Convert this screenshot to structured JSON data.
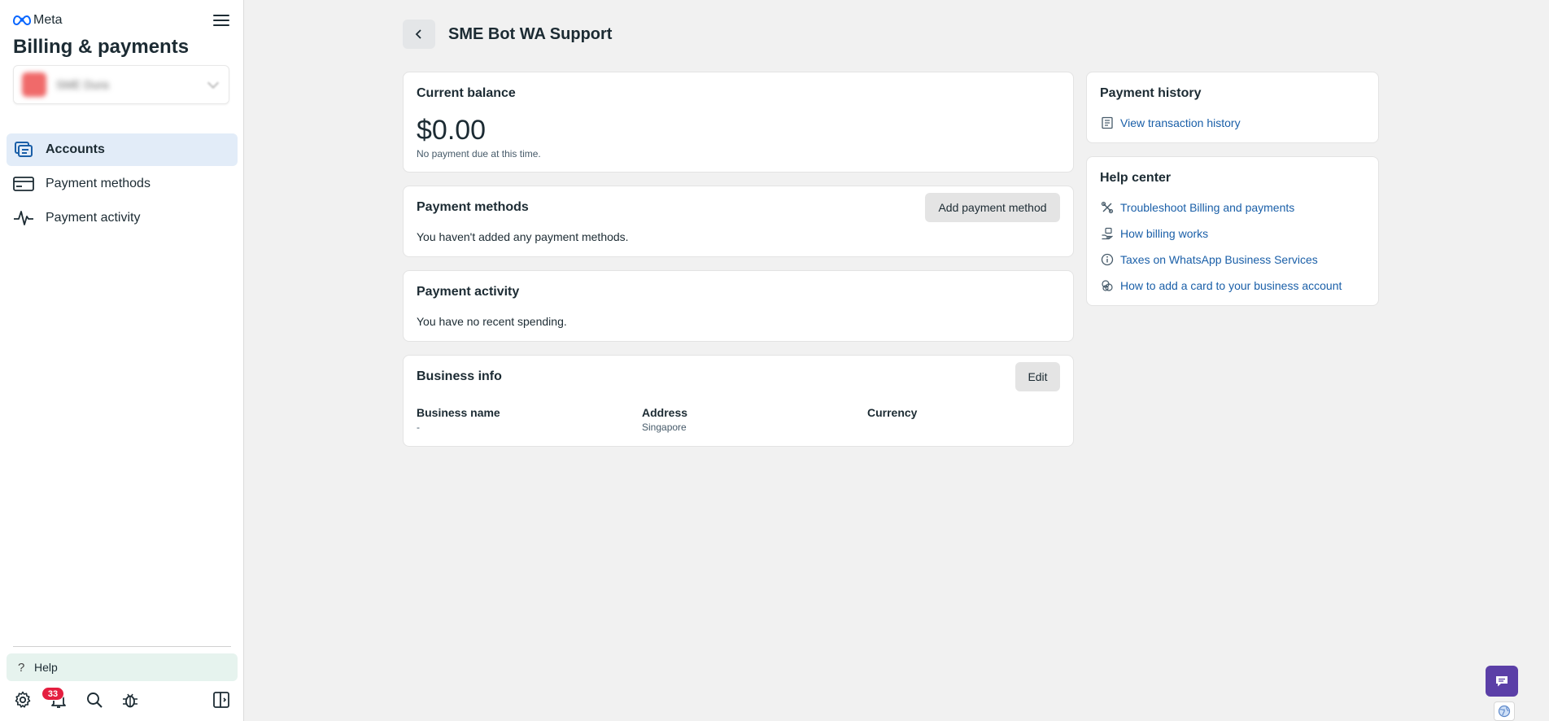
{
  "sidebar": {
    "brand": "Meta",
    "title": "Billing & payments",
    "account": {
      "name": "SME Dura"
    },
    "items": [
      {
        "label": "Accounts",
        "icon": "accounts-icon",
        "active": true
      },
      {
        "label": "Payment methods",
        "icon": "credit-card-icon",
        "active": false
      },
      {
        "label": "Payment activity",
        "icon": "activity-icon",
        "active": false
      }
    ],
    "help_label": "Help",
    "notification_count": "33"
  },
  "header": {
    "title": "SME Bot WA Support"
  },
  "balance_card": {
    "title": "Current balance",
    "amount": "$0.00",
    "note": "No payment due at this time."
  },
  "payment_methods_card": {
    "title": "Payment methods",
    "add_label": "Add payment method",
    "empty_text": "You haven't added any payment methods."
  },
  "payment_activity_card": {
    "title": "Payment activity",
    "empty_text": "You have no recent spending."
  },
  "business_info_card": {
    "title": "Business info",
    "edit_label": "Edit",
    "fields": [
      {
        "label": "Business name",
        "value": "-"
      },
      {
        "label": "Address",
        "value": "Singapore"
      },
      {
        "label": "Currency",
        "value": ""
      }
    ]
  },
  "payment_history_card": {
    "title": "Payment history",
    "link": "View transaction history"
  },
  "help_center_card": {
    "title": "Help center",
    "links": [
      "Troubleshoot Billing and payments",
      "How billing works",
      "Taxes on WhatsApp Business Services",
      "How to add a card to your business account"
    ]
  },
  "colors": {
    "link": "#1a5fa8",
    "active_nav": "#e2ecf8",
    "badge": "#e41e3f",
    "chat": "#5b3fa7",
    "background": "#f1f1f1"
  }
}
